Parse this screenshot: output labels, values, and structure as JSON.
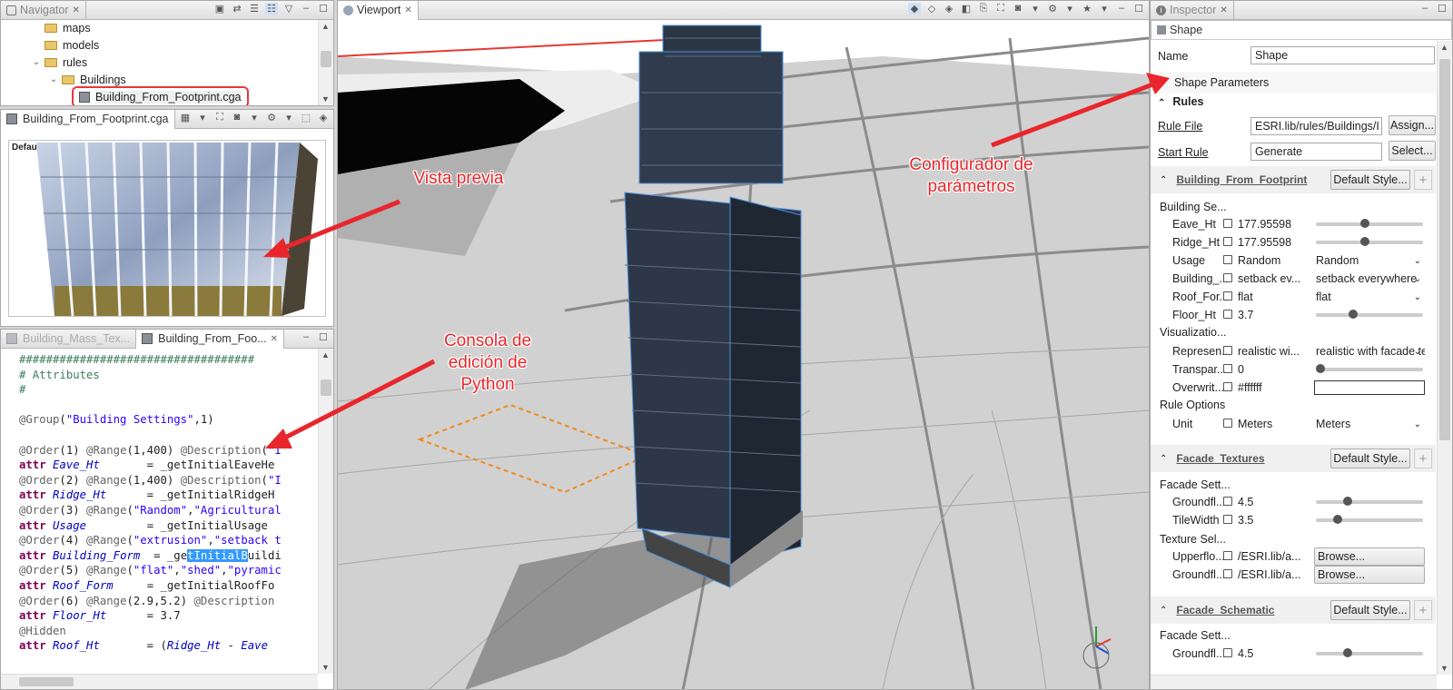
{
  "navigator": {
    "tab_label": "Navigator",
    "items": [
      {
        "label": "maps",
        "type": "folder"
      },
      {
        "label": "models",
        "type": "folder"
      },
      {
        "label": "rules",
        "type": "folder"
      },
      {
        "label": "Buildings",
        "type": "folder"
      },
      {
        "label": "Building_From_Footprint.cga",
        "type": "file",
        "selected": true
      }
    ]
  },
  "preview": {
    "tab_label": "Building_From_Footprint.cga",
    "overlay_label": "Default"
  },
  "editor": {
    "tabs": [
      {
        "label": "Building_Mass_Tex...",
        "active": false
      },
      {
        "label": "Building_From_Foo...",
        "active": true
      }
    ]
  },
  "viewport": {
    "tab_label": "Viewport"
  },
  "inspector": {
    "tab_label": "Inspector",
    "sub_tab": "Shape",
    "name_label": "Name",
    "name_value": "Shape",
    "shape_params_label": "Shape Parameters",
    "rules_label": "Rules",
    "rule_file_label": "Rule File",
    "rule_file_value": "ESRI.lib/rules/Buildings/I",
    "assign_button": "Assign...",
    "start_rule_label": "Start Rule",
    "start_rule_value": "Generate",
    "select_button": "Select...",
    "sections": {
      "building": {
        "title": "Building_From_Footprint",
        "style_button": "Default Style...",
        "group1": "Building Se...",
        "group2": "Visualizatio...",
        "group3": "Rule Options",
        "params": [
          {
            "label": "Eave_Ht",
            "value": "177.95598",
            "control": "slider",
            "level": 0.45
          },
          {
            "label": "Ridge_Ht",
            "value": "177.95598",
            "control": "slider",
            "level": 0.45
          },
          {
            "label": "Usage",
            "value": "Random",
            "control": "dropdown",
            "option": "Random"
          },
          {
            "label": "Building_...",
            "value": "setback ev...",
            "control": "dropdown",
            "option": "setback everywhere"
          },
          {
            "label": "Roof_For...",
            "value": "flat",
            "control": "dropdown",
            "option": "flat"
          },
          {
            "label": "Floor_Ht",
            "value": "3.7",
            "control": "slider",
            "level": 0.33
          },
          {
            "label": "Represen...",
            "value": "realistic wi...",
            "control": "dropdown",
            "option": "realistic with facade te"
          },
          {
            "label": "Transpar...",
            "value": "0",
            "control": "slider",
            "level": 0.0
          },
          {
            "label": "Overwrit...",
            "value": "#ffffff",
            "control": "color"
          },
          {
            "label": "Unit",
            "value": "Meters",
            "control": "dropdown",
            "option": "Meters"
          }
        ]
      },
      "facade_textures": {
        "title": "Facade_Textures",
        "style_button": "Default Style...",
        "group1": "Facade Sett...",
        "group2": "Texture Sel...",
        "params": [
          {
            "label": "Groundfl...",
            "value": "4.5",
            "control": "slider",
            "level": 0.28
          },
          {
            "label": "TileWidth",
            "value": "3.5",
            "control": "slider",
            "level": 0.18
          },
          {
            "label": "Upperflo...",
            "value": "/ESRI.lib/a...",
            "control": "browse",
            "button": "Browse..."
          },
          {
            "label": "Groundfl...",
            "value": "/ESRI.lib/a...",
            "control": "browse",
            "button": "Browse..."
          }
        ]
      },
      "facade_schematic": {
        "title": "Facade_Schematic",
        "style_button": "Default Style...",
        "group1": "Facade Sett...",
        "params": [
          {
            "label": "Groundfl...",
            "value": "4.5",
            "control": "slider",
            "level": 0.28
          }
        ]
      }
    }
  },
  "annotations": {
    "preview": "Vista previa",
    "console": "Consola de\nedición de\nPython",
    "configurator": "Configurador de\nparámetros"
  },
  "colors": {
    "annotation_red": "#e8262b",
    "selection_blue": "#3399ff",
    "highlight_box": "#e53935",
    "keyword": "#7f0055"
  }
}
